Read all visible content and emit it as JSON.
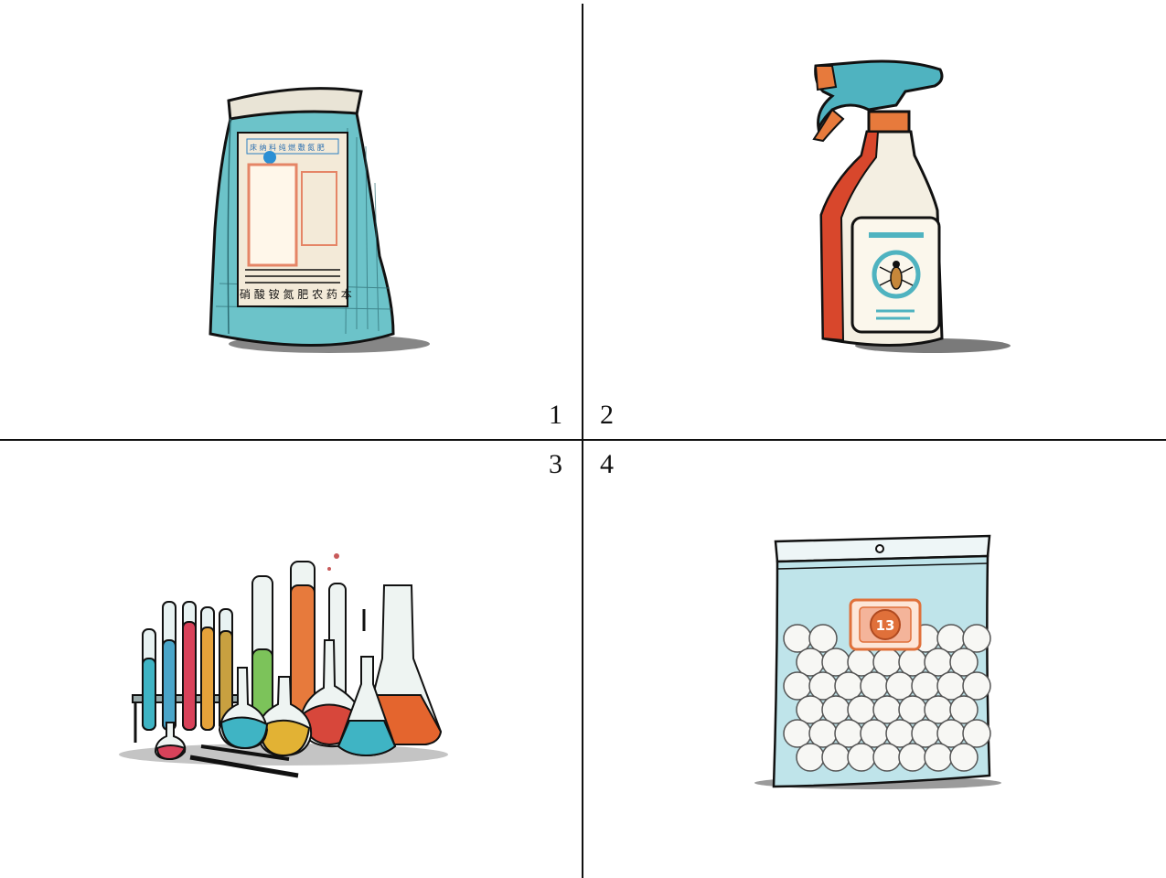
{
  "panels": [
    {
      "id": "1",
      "label": "1",
      "subject": "bag-icon"
    },
    {
      "id": "2",
      "label": "2",
      "subject": "spray-bottle-icon"
    },
    {
      "id": "3",
      "label": "3",
      "subject": "lab-glassware-icon"
    },
    {
      "id": "4",
      "label": "4",
      "subject": "ziplock-bag-balls-icon"
    }
  ],
  "bag_text": {
    "header": "床 纳 料 纯 燃 敷 氮 肥",
    "bottom": "硝 酸 铵 氮 肥 农 药 本"
  },
  "balls_bag": {
    "badge": "13"
  },
  "colors": {
    "line": "#111111",
    "teal": "#5fb8c2",
    "orange": "#e0703a",
    "cream": "#f6f1e3",
    "red": "#d8462f"
  }
}
